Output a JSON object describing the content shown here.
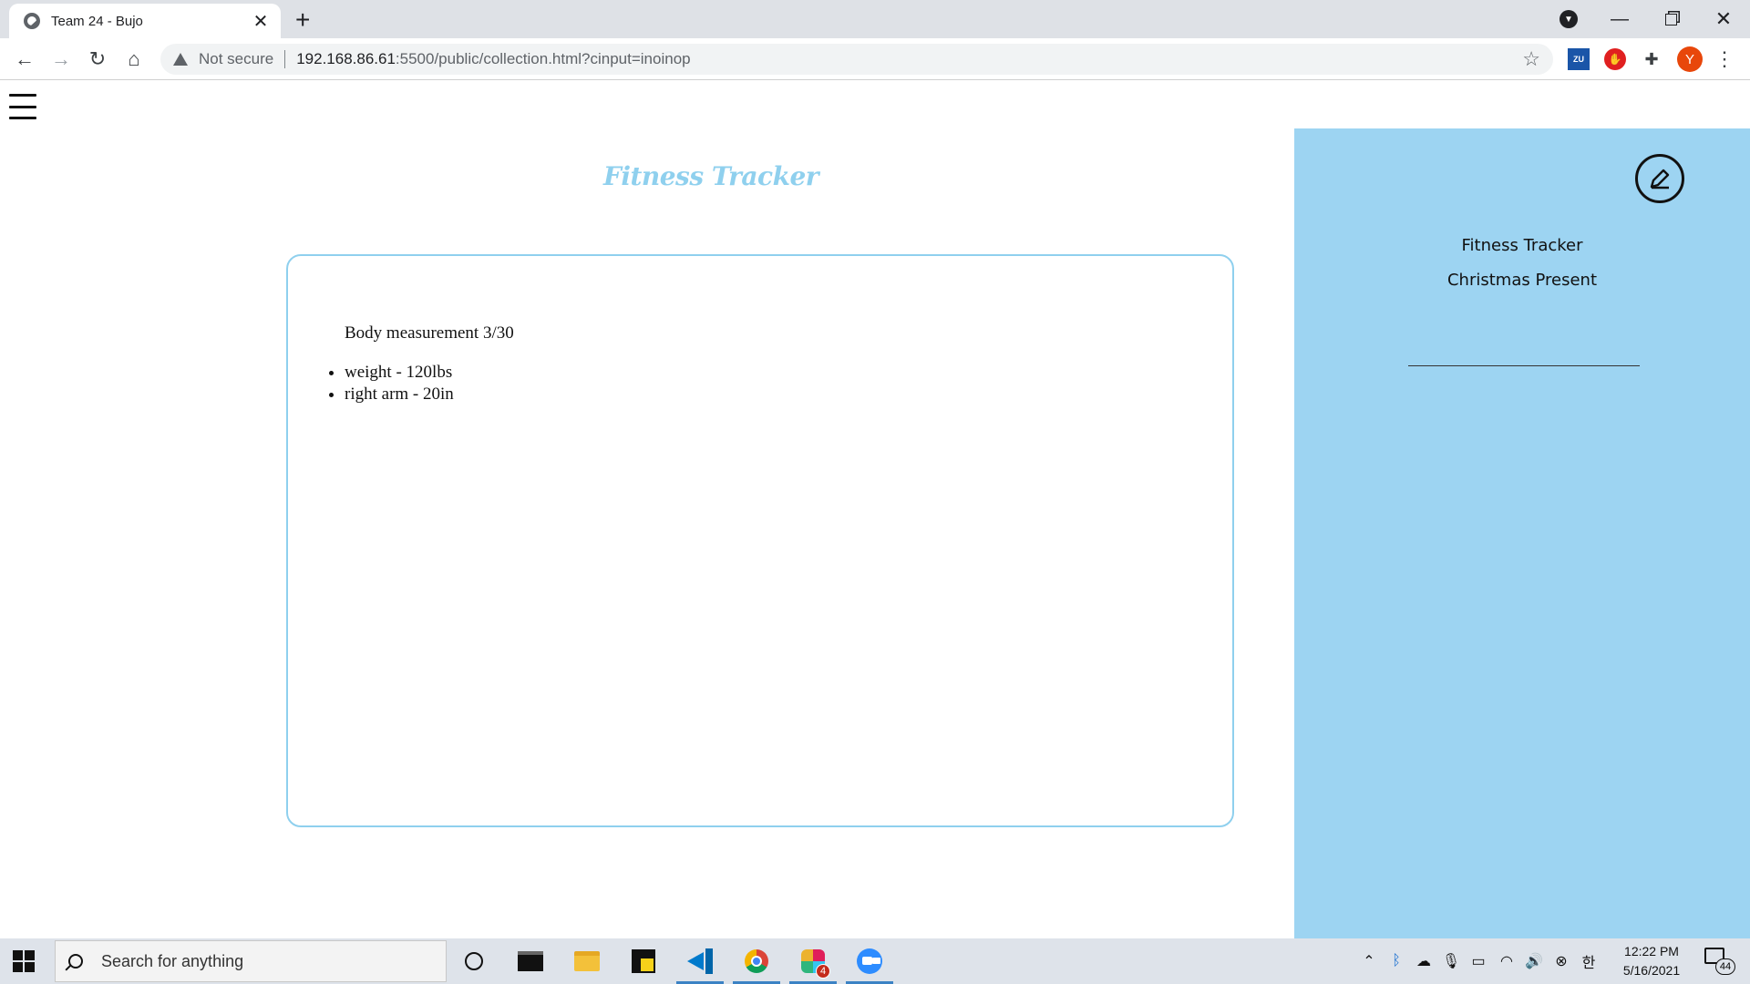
{
  "browser": {
    "tab_title": "Team 24 - Bujo",
    "tab_close": "✕",
    "new_tab": "+",
    "security_label": "Not secure",
    "url_host": "192.168.86.61",
    "url_rest": ":5500/public/collection.html?cinput=inoinop",
    "avatar_letter": "Y",
    "ext_zu": "ZU"
  },
  "page": {
    "heading": "Fitness Tracker",
    "entry": {
      "title": "Body measurement 3/30",
      "items": [
        "weight - 120lbs",
        "right arm - 20in"
      ]
    },
    "sidebar": {
      "items": [
        "Fitness Tracker",
        "Christmas Present"
      ]
    }
  },
  "taskbar": {
    "search_placeholder": "Search for anything",
    "slack_badge": "4",
    "ime": "한",
    "time": "12:22 PM",
    "date": "5/16/2021",
    "notifications": "44"
  }
}
